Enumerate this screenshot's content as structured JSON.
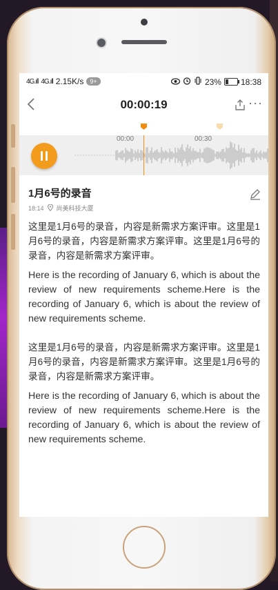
{
  "status_bar": {
    "signal1": "4G.ıll",
    "signal2": "4G.ıll",
    "speed": "2.15K/s",
    "notification_badge": "9+",
    "battery_percent": "23%",
    "time": "18:38"
  },
  "nav": {
    "title": "00:00:19"
  },
  "timeline": {
    "tick1": "00:00",
    "tick2": "00:30"
  },
  "recording": {
    "title": "1月6号的录音",
    "time": "18:14",
    "location": "尚美科技大厦",
    "paragraphs": [
      "这里是1月6号的录音，内容是新需求方案评审。这里是1月6号的录音，内容是新需求方案评审。这里是1月6号的录音，内容是新需求方案评审。",
      "Here is the recording of January 6, which is about the review of new requirements scheme.Here is the recording of January 6, which is about the review of new requirements scheme.",
      "这里是1月6号的录音，内容是新需求方案评审。这里是1月6号的录音，内容是新需求方案评审。这里是1月6号的录音，内容是新需求方案评审。",
      "Here is the recording of January 6, which is about the review of new requirements scheme.Here is the recording of January 6, which is about the review of new requirements scheme."
    ]
  },
  "colors": {
    "accent": "#f39b1c",
    "waveform": "#a9a9a9"
  },
  "icons": {
    "back": "chevron-left-icon",
    "share": "share-icon",
    "more": "more-icon",
    "pause": "pause-icon",
    "edit": "pencil-icon",
    "location": "location-pin-icon"
  }
}
